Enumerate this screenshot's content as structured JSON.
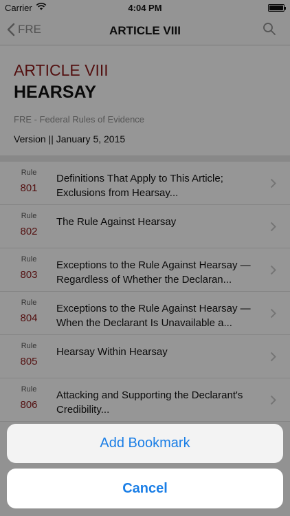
{
  "status_bar": {
    "carrier": "Carrier",
    "time": "4:04 PM"
  },
  "nav": {
    "back_label": "FRE",
    "title": "ARTICLE VIII",
    "back_icon": "chevron-left-icon",
    "search_icon": "search-icon"
  },
  "header": {
    "article": "ARTICLE VIII",
    "subtitle": "HEARSAY",
    "source": "FRE - Federal Rules of Evidence",
    "version": "Version || January 5, 2015"
  },
  "rules": [
    {
      "label": "Rule",
      "number": "801",
      "text": "Definitions That Apply to This Article; Exclusions from Hearsay..."
    },
    {
      "label": "Rule",
      "number": "802",
      "text": "The Rule Against Hearsay"
    },
    {
      "label": "Rule",
      "number": "803",
      "text": "Exceptions to the Rule Against Hearsay —Regardless of Whether the Declaran..."
    },
    {
      "label": "Rule",
      "number": "804",
      "text": "Exceptions to the Rule Against Hearsay —When the Declarant Is Unavailable a..."
    },
    {
      "label": "Rule",
      "number": "805",
      "text": "Hearsay Within Hearsay"
    },
    {
      "label": "Rule",
      "number": "806",
      "text": "Attacking and Supporting the Declarant's Credibility..."
    }
  ],
  "action_sheet": {
    "add_bookmark": "Add Bookmark",
    "cancel": "Cancel"
  },
  "colors": {
    "accent_red": "#8b1c1c",
    "action_blue": "#1a7ee6"
  }
}
